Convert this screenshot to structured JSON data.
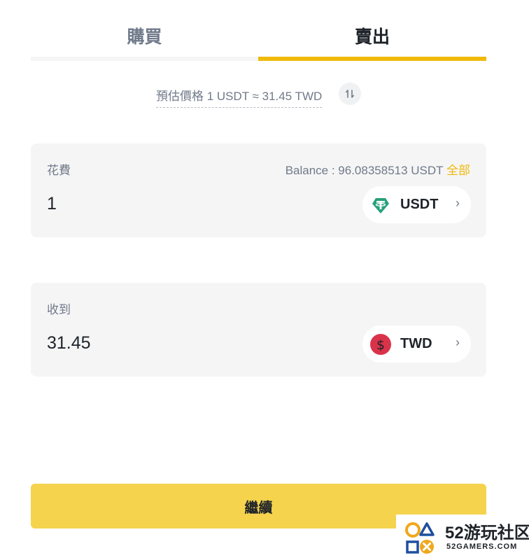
{
  "tabs": {
    "buy": "購買",
    "sell": "賣出",
    "active": "sell"
  },
  "rate": {
    "text": "預估價格 1 USDT ≈ 31.45 TWD",
    "swap_icon": "swap-arrows-icon"
  },
  "spend": {
    "label": "花費",
    "balance_text": "Balance : 96.08358513 USDT",
    "balance_all": "全部",
    "amount": "1",
    "coin": "USDT",
    "coin_icon": "tether-icon",
    "coin_color": "#26a17b"
  },
  "receive": {
    "label": "收到",
    "amount": "31.45",
    "coin": "TWD",
    "coin_icon": "dollar-icon",
    "coin_color": "#d9334a"
  },
  "continue_label": "繼續",
  "watermark": {
    "title": "52游玩社区",
    "sub": "52GAMERS.COM"
  },
  "colors": {
    "accent": "#f0b90b",
    "button": "#f5d34d",
    "card": "#f5f5f5",
    "muted_text": "#707a8a"
  }
}
